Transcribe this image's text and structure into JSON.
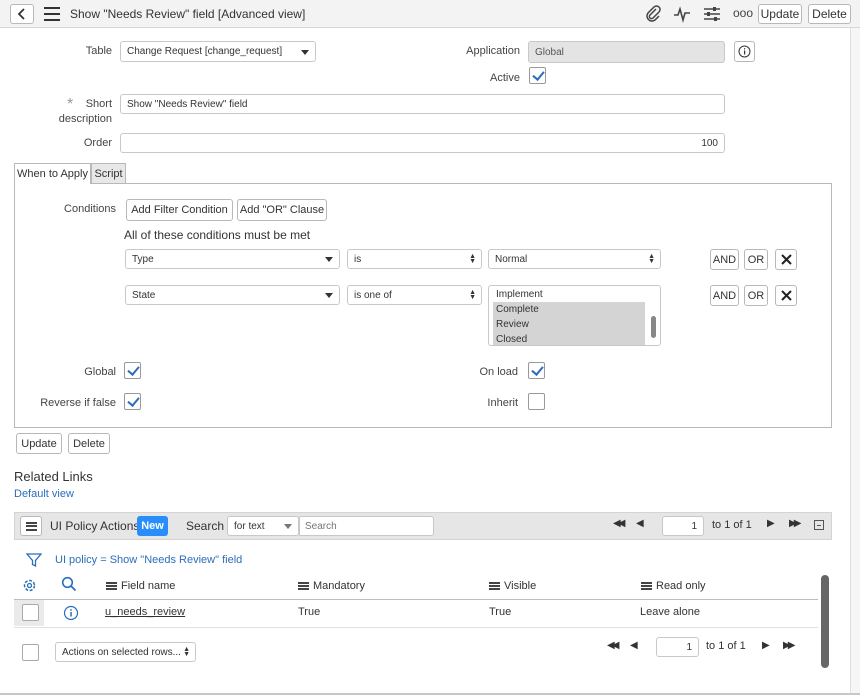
{
  "header": {
    "title": "Show \"Needs Review\" field [Advanced view]",
    "update_label": "Update",
    "delete_label": "Delete",
    "more_label": "ooo"
  },
  "form": {
    "table_label": "Table",
    "table_value": "Change Request [change_request]",
    "application_label": "Application",
    "application_value": "Global",
    "active_label": "Active",
    "active_checked": true,
    "short_desc_label_1": "Short",
    "short_desc_label_2": "description",
    "short_desc_value": "Show \"Needs Review\" field",
    "order_label": "Order",
    "order_value": "100"
  },
  "tabs": {
    "when_to_apply": "When to Apply",
    "script": "Script"
  },
  "conditions": {
    "label": "Conditions",
    "add_filter": "Add Filter Condition",
    "add_or": "Add \"OR\" Clause",
    "all_met": "All of these conditions must be met",
    "rows": [
      {
        "field": "Type",
        "operator": "is",
        "value": "Normal"
      },
      {
        "field": "State",
        "operator": "is one of",
        "list": [
          "Implement",
          "Complete",
          "Review",
          "Closed"
        ]
      }
    ],
    "and_label": "AND",
    "or_label": "OR"
  },
  "options": {
    "global_label": "Global",
    "global_checked": true,
    "onload_label": "On load",
    "onload_checked": true,
    "reverse_label": "Reverse if false",
    "reverse_checked": true,
    "inherit_label": "Inherit",
    "inherit_checked": false
  },
  "bottom_buttons": {
    "update": "Update",
    "delete": "Delete"
  },
  "related": {
    "title": "Related Links",
    "default_view": "Default view"
  },
  "list": {
    "title": "UI Policy Actions",
    "new_label": "New",
    "search_label": "Search",
    "search_for": "for text",
    "search_placeholder": "Search",
    "page_value": "1",
    "page_range": "to 1 of 1",
    "breadcrumb": "UI policy = Show \"Needs Review\" field",
    "columns": [
      "Field name",
      "Mandatory",
      "Visible",
      "Read only"
    ],
    "rows": [
      {
        "field_name": "u_needs_review",
        "mandatory": "True",
        "visible": "True",
        "read_only": "Leave alone"
      }
    ],
    "actions_label": "Actions on selected rows..."
  },
  "colors": {
    "accent": "#2a6ebb",
    "new_button": "#278efc"
  }
}
